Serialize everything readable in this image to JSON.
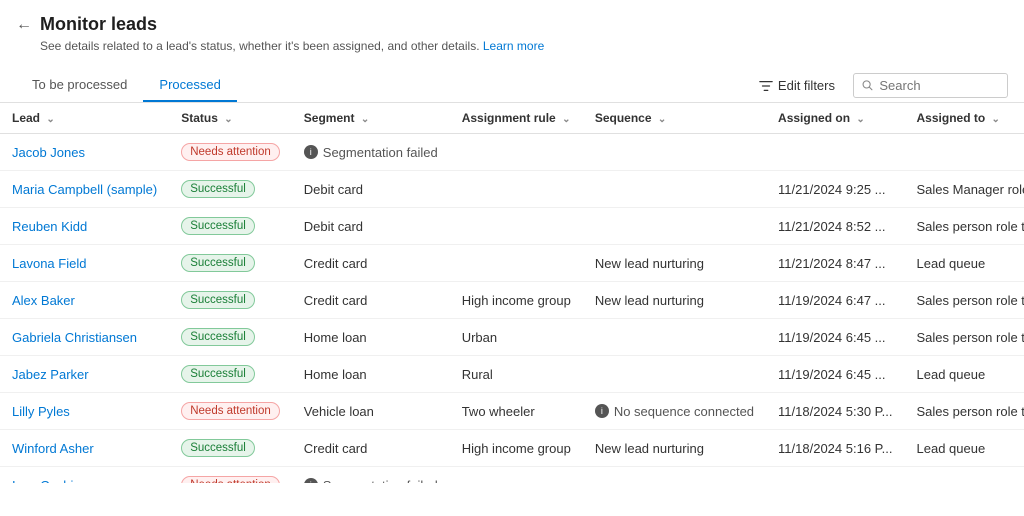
{
  "header": {
    "title": "Monitor leads",
    "subtitle": "See details related to a lead's status, whether it's been assigned, and other details.",
    "learn_more": "Learn more",
    "back_icon": "←"
  },
  "tabs": [
    {
      "label": "To be processed",
      "active": false
    },
    {
      "label": "Processed",
      "active": true
    }
  ],
  "toolbar": {
    "edit_filters_label": "Edit filters",
    "search_placeholder": "Search"
  },
  "table": {
    "columns": [
      {
        "key": "lead",
        "label": "Lead"
      },
      {
        "key": "status",
        "label": "Status"
      },
      {
        "key": "segment",
        "label": "Segment"
      },
      {
        "key": "assignment_rule",
        "label": "Assignment rule"
      },
      {
        "key": "sequence",
        "label": "Sequence"
      },
      {
        "key": "assigned_on",
        "label": "Assigned on"
      },
      {
        "key": "assigned_to",
        "label": "Assigned to"
      }
    ],
    "rows": [
      {
        "lead": "Jacob Jones",
        "status": "Needs attention",
        "status_type": "attention",
        "segment": "Segmentation failed",
        "segment_icon": true,
        "assignment_rule": "",
        "sequence": "",
        "sequence_icon": false,
        "assigned_on": "",
        "assigned_to": ""
      },
      {
        "lead": "Maria Campbell (sample)",
        "status": "Successful",
        "status_type": "success",
        "segment": "Debit card",
        "segment_icon": false,
        "assignment_rule": "",
        "sequence": "",
        "sequence_icon": false,
        "assigned_on": "11/21/2024 9:25 ...",
        "assigned_to": "Sales Manager role te..."
      },
      {
        "lead": "Reuben Kidd",
        "status": "Successful",
        "status_type": "success",
        "segment": "Debit card",
        "segment_icon": false,
        "assignment_rule": "",
        "sequence": "",
        "sequence_icon": false,
        "assigned_on": "11/21/2024 8:52 ...",
        "assigned_to": "Sales person role team"
      },
      {
        "lead": "Lavona Field",
        "status": "Successful",
        "status_type": "success",
        "segment": "Credit card",
        "segment_icon": false,
        "assignment_rule": "",
        "sequence": "New lead nurturing",
        "sequence_icon": false,
        "assigned_on": "11/21/2024 8:47 ...",
        "assigned_to": "Lead queue"
      },
      {
        "lead": "Alex Baker",
        "status": "Successful",
        "status_type": "success",
        "segment": "Credit card",
        "segment_icon": false,
        "assignment_rule": "High income group",
        "sequence": "New lead nurturing",
        "sequence_icon": false,
        "assigned_on": "11/19/2024 6:47 ...",
        "assigned_to": "Sales person role team"
      },
      {
        "lead": "Gabriela Christiansen",
        "status": "Successful",
        "status_type": "success",
        "segment": "Home loan",
        "segment_icon": false,
        "assignment_rule": "Urban",
        "sequence": "",
        "sequence_icon": false,
        "assigned_on": "11/19/2024 6:45 ...",
        "assigned_to": "Sales person role team"
      },
      {
        "lead": "Jabez Parker",
        "status": "Successful",
        "status_type": "success",
        "segment": "Home loan",
        "segment_icon": false,
        "assignment_rule": "Rural",
        "sequence": "",
        "sequence_icon": false,
        "assigned_on": "11/19/2024 6:45 ...",
        "assigned_to": "Lead queue"
      },
      {
        "lead": "Lilly Pyles",
        "status": "Needs attention",
        "status_type": "attention",
        "segment": "Vehicle loan",
        "segment_icon": false,
        "assignment_rule": "Two wheeler",
        "sequence": "No sequence connected",
        "sequence_icon": true,
        "assigned_on": "11/18/2024 5:30 P...",
        "assigned_to": "Sales person role team"
      },
      {
        "lead": "Winford Asher",
        "status": "Successful",
        "status_type": "success",
        "segment": "Credit card",
        "segment_icon": false,
        "assignment_rule": "High income group",
        "sequence": "New lead nurturing",
        "sequence_icon": false,
        "assigned_on": "11/18/2024 5:16 P...",
        "assigned_to": "Lead queue"
      },
      {
        "lead": "Ivan Cashin",
        "status": "Needs attention",
        "status_type": "attention",
        "segment": "Segmentation failed",
        "segment_icon": true,
        "assignment_rule": "",
        "sequence": "",
        "sequence_icon": false,
        "assigned_on": "",
        "assigned_to": ""
      }
    ]
  }
}
